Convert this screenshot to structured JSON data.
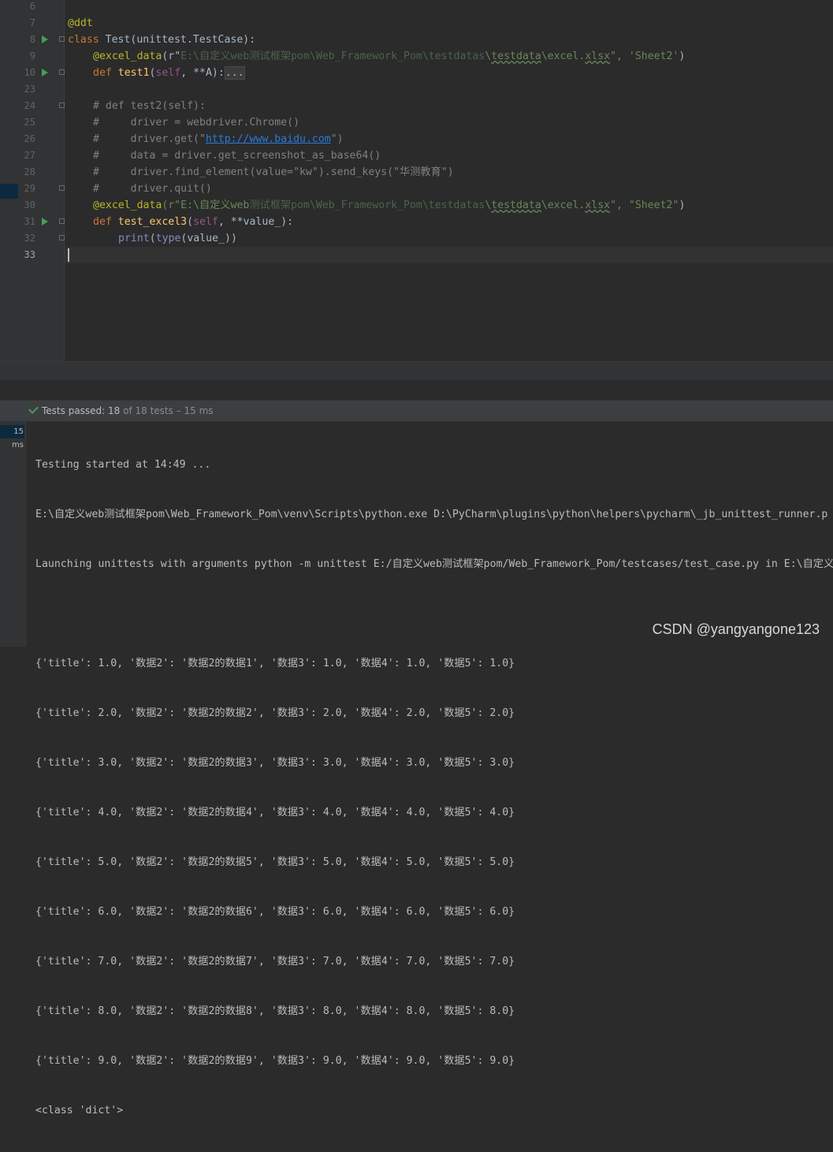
{
  "editor": {
    "line_numbers": [
      "6",
      "7",
      "8",
      "9",
      "10",
      "23",
      "24",
      "25",
      "26",
      "27",
      "28",
      "29",
      "30",
      "31",
      "32",
      "33"
    ],
    "lines": {
      "l7": "@ddt",
      "l8_kw": "class ",
      "l8_rest": "Test(unittest.TestCase):",
      "l9_dec": "@excel_data",
      "l9_a": "(r\"",
      "l9_blur": "E:\\自定义web测试框架pom\\Web_Framework_Pom\\testdatas",
      "l9_b": "\\",
      "l9_sq": "testdata",
      "l9_c": "\\excel.",
      "l9_sq2": "xlsx",
      "l9_d": "\", 'Sheet2'",
      "l9_e": ")",
      "l10_kw": "def ",
      "l10_fn": "test1",
      "l10_a": "(",
      "l10_self": "self",
      "l10_b": ", **A):",
      "l10_fold": "...",
      "l24": "# def test2(self):",
      "l25": "#     driver = webdriver.Chrome()",
      "l26_a": "#     driver.get(\"",
      "l26_url": "http://www.baidu.com",
      "l26_b": "\")",
      "l27": "#     data = driver.get_screenshot_as_base64()",
      "l28": "#     driver.find_element(value=\"kw\").send_keys(\"华测教育\")",
      "l29": "#     driver.quit()",
      "l30_dec": "@excel_data",
      "l30_a": "(r\"E:\\自定义web",
      "l30_blur": "测试框架pom\\Web_Framework_Pom\\testdatas",
      "l30_b": "\\",
      "l30_sq": "testdata",
      "l30_c": "\\excel.",
      "l30_sq2": "xlsx",
      "l30_d": "\", \"Sheet2\"",
      "l30_e": ")",
      "l31_kw": "def ",
      "l31_fn": "test_excel3",
      "l31_a": "(",
      "l31_self": "self",
      "l31_b": ", **value_):",
      "l32_bi": "print",
      "l32_a": "(",
      "l32_bi2": "type",
      "l32_b": "(value_))"
    }
  },
  "run": {
    "status_label": "Tests passed: ",
    "passed": "18",
    "of_text": " of 18 tests – 15 ms",
    "time_badge": "15 ms",
    "console": [
      "Testing started at 14:49 ...",
      "E:\\自定义web测试框架pom\\Web_Framework_Pom\\venv\\Scripts\\python.exe D:\\PyCharm\\plugins\\python\\helpers\\pycharm\\_jb_unittest_runner.p",
      "Launching unittests with arguments python -m unittest E:/自定义web测试框架pom/Web_Framework_Pom/testcases/test_case.py in E:\\自定义",
      "",
      "{'title': 1.0, '数据2': '数据2的数据1', '数据3': 1.0, '数据4': 1.0, '数据5': 1.0}",
      "{'title': 2.0, '数据2': '数据2的数据2', '数据3': 2.0, '数据4': 2.0, '数据5': 2.0}",
      "{'title': 3.0, '数据2': '数据2的数据3', '数据3': 3.0, '数据4': 3.0, '数据5': 3.0}",
      "{'title': 4.0, '数据2': '数据2的数据4', '数据3': 4.0, '数据4': 4.0, '数据5': 4.0}",
      "{'title': 5.0, '数据2': '数据2的数据5', '数据3': 5.0, '数据4': 5.0, '数据5': 5.0}",
      "{'title': 6.0, '数据2': '数据2的数据6', '数据3': 6.0, '数据4': 6.0, '数据5': 6.0}",
      "{'title': 7.0, '数据2': '数据2的数据7', '数据3': 7.0, '数据4': 7.0, '数据5': 7.0}",
      "{'title': 8.0, '数据2': '数据2的数据8', '数据3': 8.0, '数据4': 8.0, '数据5': 8.0}",
      "{'title': 9.0, '数据2': '数据2的数据9', '数据3': 9.0, '数据4': 9.0, '数据5': 9.0}",
      "<class 'dict'>"
    ]
  },
  "watermark": "CSDN @yangyangone123"
}
